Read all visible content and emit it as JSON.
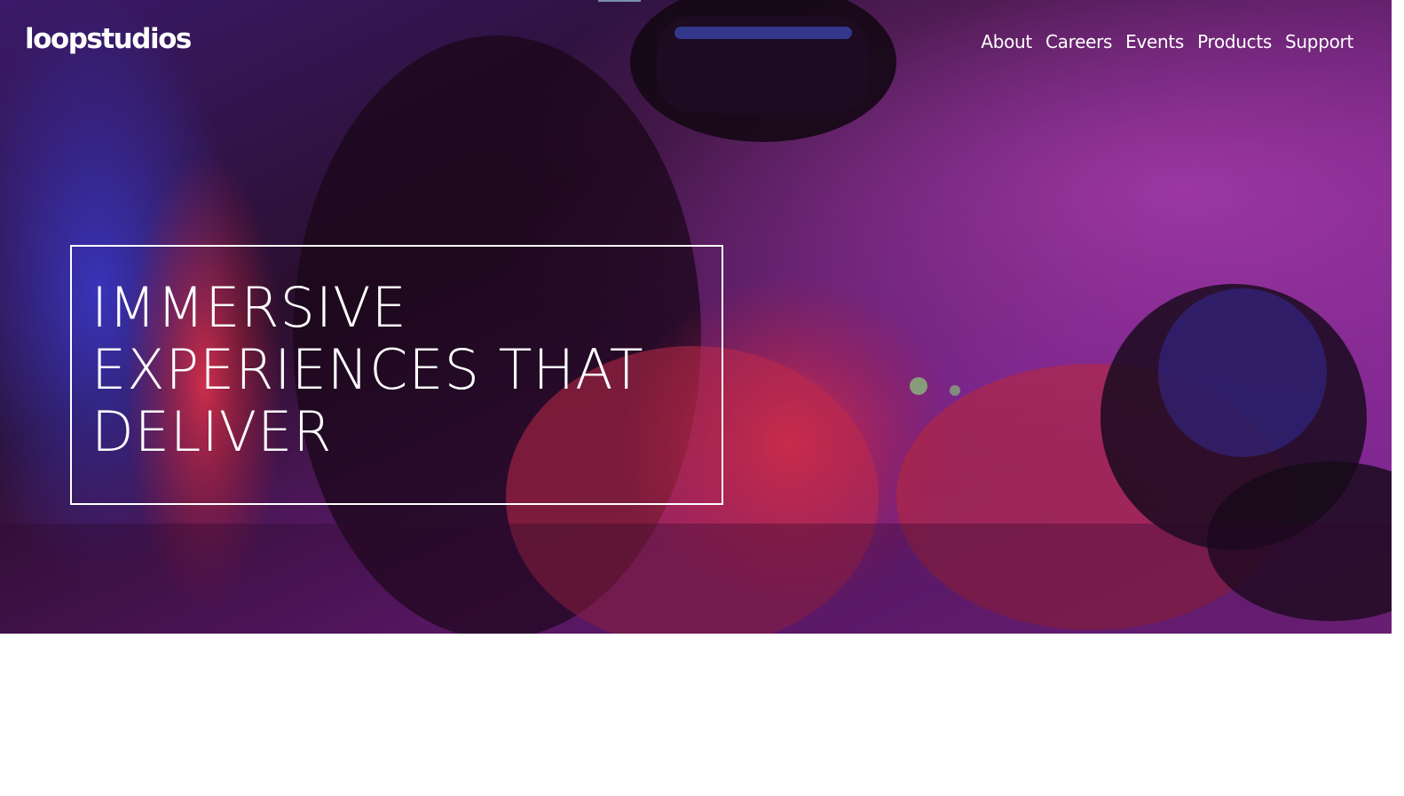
{
  "header": {
    "logo_text": "loopstudios",
    "nav": [
      {
        "label": "About"
      },
      {
        "label": "Careers"
      },
      {
        "label": "Events"
      },
      {
        "label": "Products"
      },
      {
        "label": "Support"
      }
    ]
  },
  "hero": {
    "headline": "IMMERSIVE EXPERIENCES THAT DELIVER"
  },
  "colors": {
    "text": "#ffffff",
    "hero_tint_purple": "#6a1f8c",
    "hero_tint_red": "#c0243c",
    "hero_tint_blue": "#2a2fa8",
    "page_background": "#ffffff"
  }
}
